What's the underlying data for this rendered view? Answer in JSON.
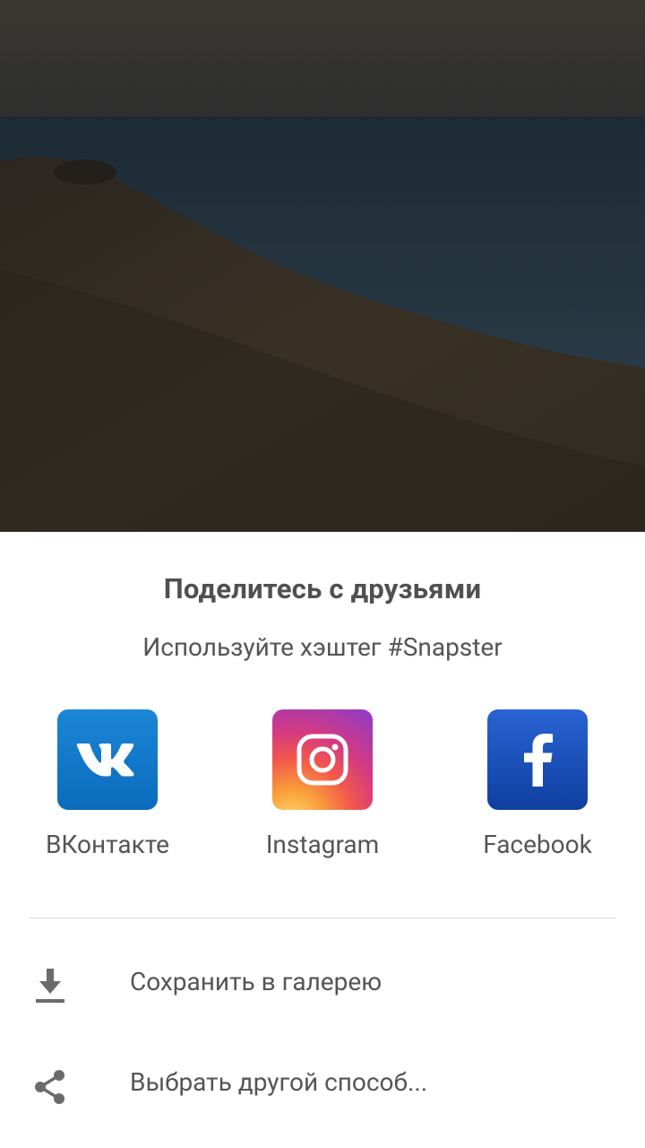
{
  "share_sheet": {
    "title": "Поделитесь с друзьями",
    "subtitle": "Используйте хэштег #Snapster",
    "apps": [
      {
        "label": "ВКонтакте",
        "icon": "vk-logo-icon",
        "color": "#0f73c6"
      },
      {
        "label": "Instagram",
        "icon": "instagram-logo-icon",
        "color": "#d43a82"
      },
      {
        "label": "Facebook",
        "icon": "facebook-logo-icon",
        "color": "#1a4fb8"
      }
    ],
    "actions": [
      {
        "label": "Сохранить в галерею",
        "icon": "download-icon"
      },
      {
        "label": "Выбрать другой способ...",
        "icon": "share-icon"
      }
    ]
  },
  "colors": {
    "text": "#555555",
    "title": "#505050",
    "divider": "#dcdcdc",
    "icon_gray": "#6b6b6b"
  }
}
